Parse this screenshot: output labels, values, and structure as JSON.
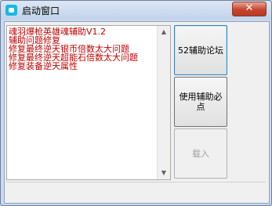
{
  "window": {
    "title": "启动窗口",
    "close_glyph": "✕"
  },
  "log": {
    "lines": [
      "魂羽爆枪英雄魂辅助V1.2",
      "辅助问题修复",
      "修复最终逆天银币倍数太大问题",
      "修复最终逆天超能石倍数太大问题",
      "修复装备逆天属性"
    ],
    "text_color": "#c00000"
  },
  "buttons": {
    "forum": "52辅助论坛",
    "must_read": "使用辅助必点",
    "load": "载入"
  },
  "icons": {
    "scroll_up": "▲",
    "scroll_down": "▼"
  }
}
